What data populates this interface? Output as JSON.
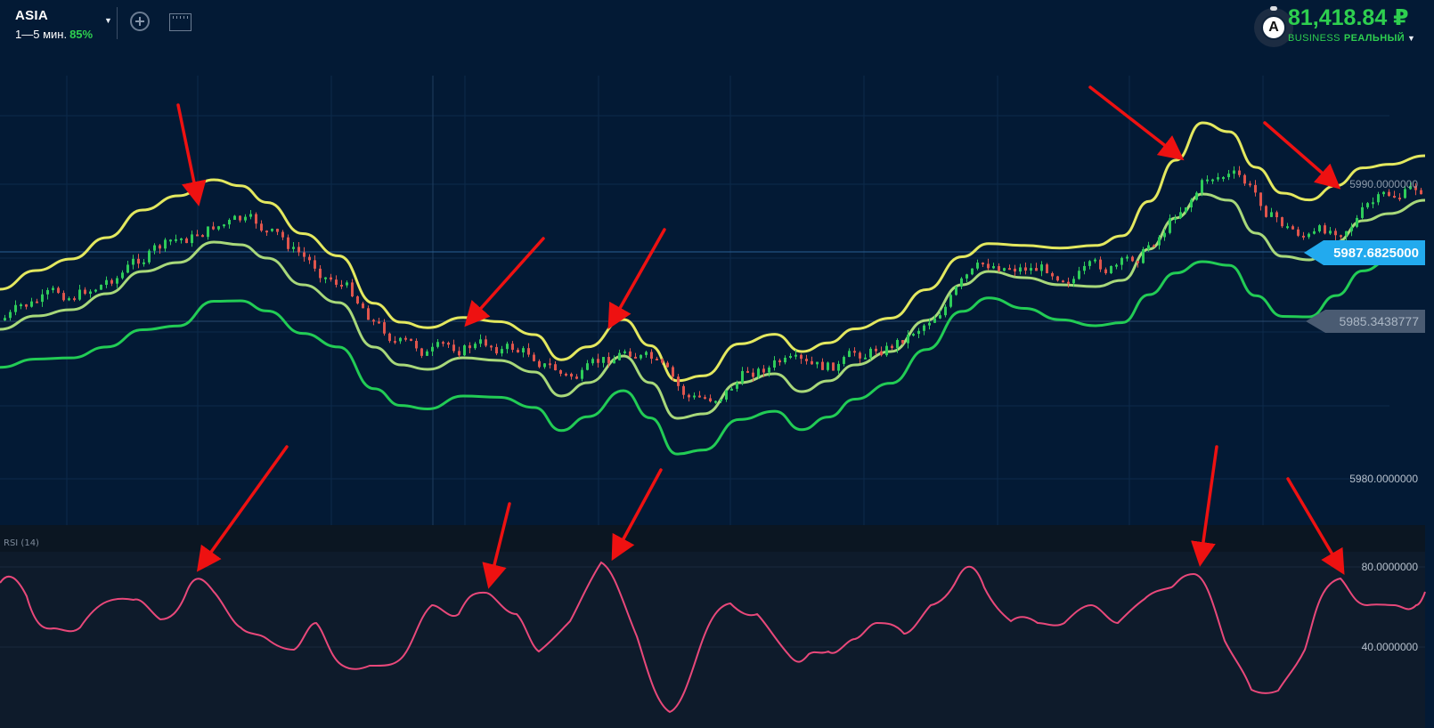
{
  "header": {
    "asset_name": "ASIA",
    "timeframe": "1—5 мин.",
    "payout": "85%",
    "add_tooltip": "",
    "avatar_letter": "A",
    "balance": "81,418.84 ₽",
    "account_type": "BUSINESS",
    "account_mode": "РЕАЛЬНЫЙ"
  },
  "price_axis": {
    "labels": [
      "5990.0000000",
      "5980.0000000"
    ],
    "current_price": "5987.6825000",
    "marker_price": "5985.3438777"
  },
  "rsi": {
    "label": "RSI (14)",
    "levels": [
      "80.0000000",
      "40.0000000"
    ]
  },
  "colors": {
    "background": "#031a35",
    "rsi_background": "#0e1b2b",
    "band_upper": "#e3e85f",
    "band_middle": "#a8d87a",
    "band_lower": "#22cc55",
    "candle_up": "#2ecc5a",
    "candle_down": "#e0554d",
    "rsi_line": "#e8487a",
    "arrow": "#ee1111",
    "current_price_tag": "#22aaee",
    "marker_tag": "#4a5b72"
  }
}
